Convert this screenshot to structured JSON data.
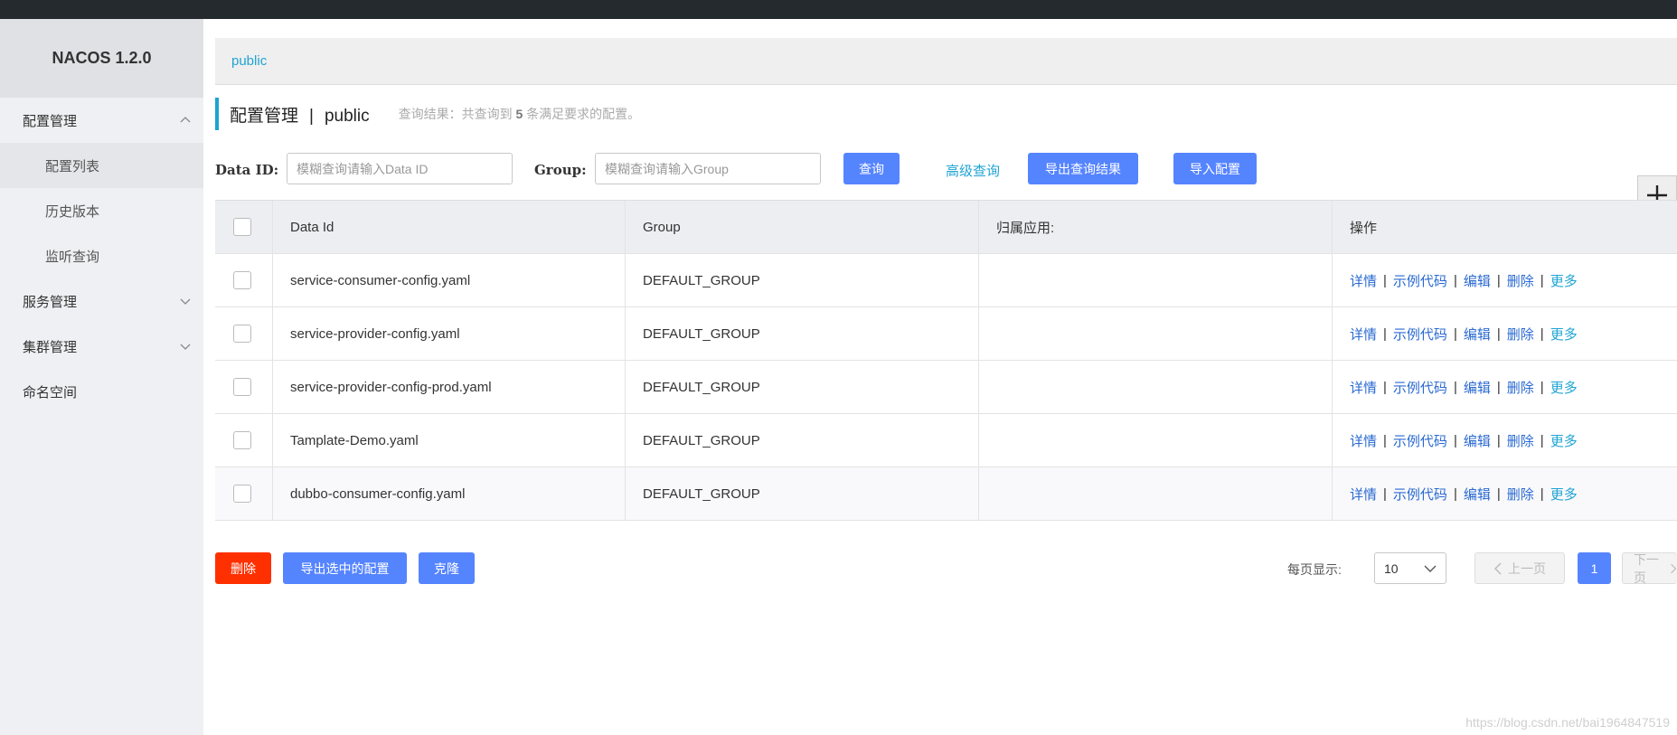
{
  "app": {
    "title": "NACOS 1.2.0"
  },
  "sidebar": {
    "groups": [
      {
        "label": "配置管理",
        "expanded": true,
        "items": [
          {
            "label": "配置列表",
            "active": true
          },
          {
            "label": "历史版本"
          },
          {
            "label": "监听查询"
          }
        ]
      },
      {
        "label": "服务管理",
        "expanded": false
      },
      {
        "label": "集群管理",
        "expanded": false
      },
      {
        "label": "命名空间"
      }
    ]
  },
  "breadcrumb": {
    "namespace": "public"
  },
  "header": {
    "title": "配置管理",
    "separator": "|",
    "namespace": "public",
    "hint_prefix": "查询结果：共查询到",
    "hint_count": "5",
    "hint_suffix": "条满足要求的配置。"
  },
  "filters": {
    "data_id_label": "Data ID:",
    "data_id_placeholder": "模糊查询请输入Data ID",
    "group_label": "Group:",
    "group_placeholder": "模糊查询请输入Group",
    "search_button": "查询",
    "advanced_link": "高级查询",
    "export_results_button": "导出查询结果",
    "import_button": "导入配置",
    "add_button": "+"
  },
  "table": {
    "columns": [
      "Data Id",
      "Group",
      "归属应用:",
      "操作"
    ],
    "rows": [
      {
        "data_id": "service-consumer-config.yaml",
        "group": "DEFAULT_GROUP",
        "app": ""
      },
      {
        "data_id": "service-provider-config.yaml",
        "group": "DEFAULT_GROUP",
        "app": ""
      },
      {
        "data_id": "service-provider-config-prod.yaml",
        "group": "DEFAULT_GROUP",
        "app": ""
      },
      {
        "data_id": "Tamplate-Demo.yaml",
        "group": "DEFAULT_GROUP",
        "app": ""
      },
      {
        "data_id": "dubbo-consumer-config.yaml",
        "group": "DEFAULT_GROUP",
        "app": ""
      }
    ],
    "ops": {
      "detail": "详情",
      "sample": "示例代码",
      "edit": "编辑",
      "delete": "删除",
      "more": "更多",
      "sep": "|"
    }
  },
  "footer": {
    "delete_button": "删除",
    "export_selected_button": "导出选中的配置",
    "clone_button": "克隆",
    "page_size_label": "每页显示:",
    "page_size_value": "10",
    "prev_button": "上一页",
    "current_page": "1",
    "next_button": "下一页"
  },
  "watermark": "https://blog.csdn.net/bai1964847519",
  "colors": {
    "accent": "#5584ff",
    "danger": "#ff3000",
    "link": "#1fa4d3",
    "topbar": "#252a2f"
  }
}
